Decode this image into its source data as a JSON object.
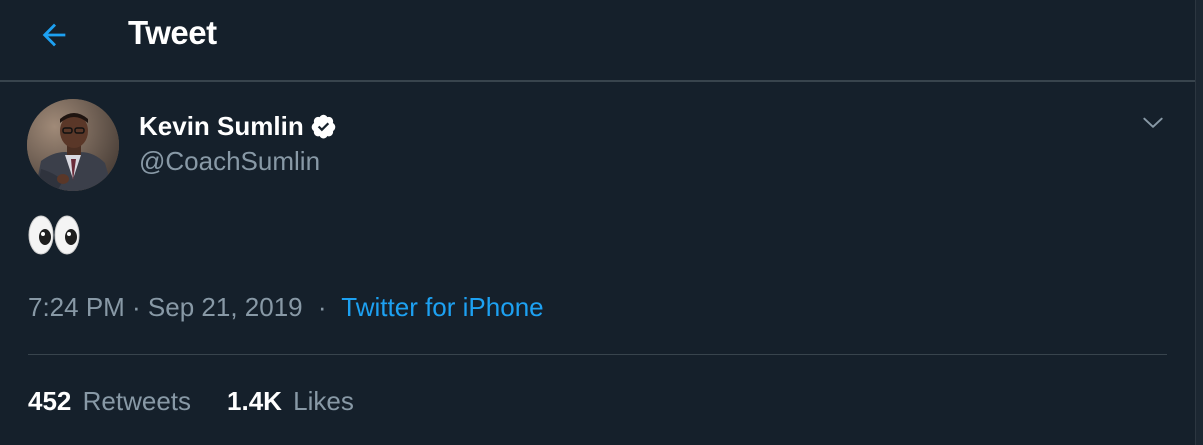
{
  "header": {
    "title": "Tweet",
    "back_icon": "arrow-left-icon",
    "accent": "#1da1f2"
  },
  "tweet": {
    "author": {
      "name": "Kevin Sumlin",
      "handle": "@CoachSumlin",
      "verified": true,
      "verified_icon": "verified-badge-icon"
    },
    "body": "👀",
    "timestamp": "7:24 PM · Sep 21, 2019",
    "separator": "·",
    "source": "Twitter for iPhone",
    "stats": {
      "retweets_count": "452",
      "retweets_label": "Retweets",
      "likes_count": "1.4K",
      "likes_label": "Likes"
    }
  },
  "colors": {
    "background": "#15202b",
    "border": "#38444d",
    "secondary_text": "#8899a6",
    "link": "#1da1f2"
  }
}
